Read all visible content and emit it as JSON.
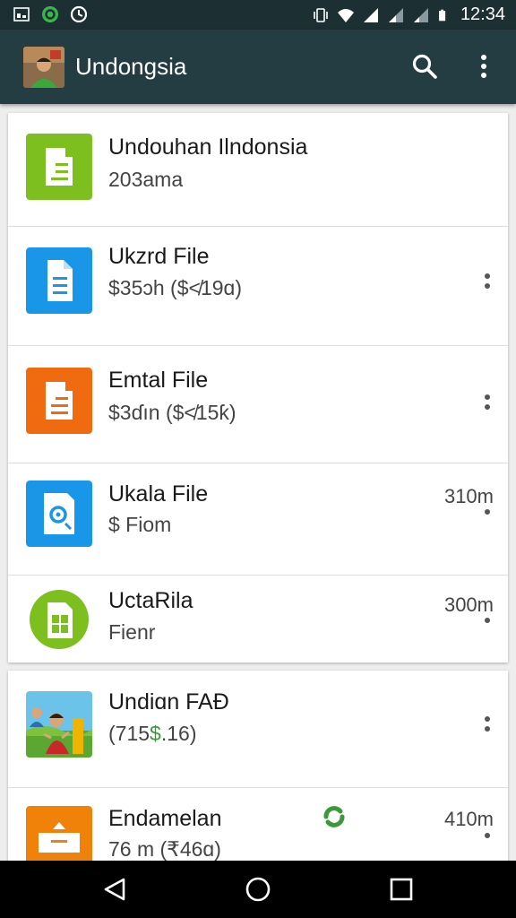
{
  "status_bar": {
    "time": "12:34",
    "icons": [
      "notification-icon",
      "sync-icon",
      "data-saver-icon",
      "vibrate-icon",
      "wifi-icon",
      "signal-icon",
      "signal-icon",
      "battery-icon"
    ]
  },
  "app_bar": {
    "title": "Undongsia",
    "icons": [
      "avatar",
      "search-icon",
      "more-vert-icon"
    ]
  },
  "list_group_1": [
    {
      "title": "Undouhan Ilndonsia",
      "subtitle": "203ama",
      "meta": "",
      "icon": "document-icon",
      "icon_color": "#7cbf1f",
      "has_menu": false
    },
    {
      "title": "Ukzrd File",
      "subtitle": "$35ɔh ($≮19ɑ)",
      "meta": "",
      "icon": "file-icon",
      "icon_color": "#1a96e8",
      "has_menu": true
    },
    {
      "title": "Emtal File",
      "subtitle": "$3ɗın ($≮15ƙ)",
      "meta": "",
      "icon": "document-icon",
      "icon_color": "#f06a10",
      "has_menu": true
    },
    {
      "title": "Ukala File",
      "subtitle": "$ Fiom",
      "meta": "310m",
      "icon": "audio-file-icon",
      "icon_color": "#1a96e8",
      "has_menu": true
    },
    {
      "title": "UctaRila",
      "subtitle": "Fienr",
      "meta": "300m",
      "icon": "spreadsheet-icon",
      "icon_color": "#7cbf1f",
      "has_menu": true
    }
  ],
  "list_group_2": [
    {
      "title": "Undiɑn FAÐ",
      "subtitle_before": "(715",
      "subtitle_accent": "$",
      "subtitle_after": ".16)",
      "meta": "",
      "icon": "photo-thumbnail",
      "has_menu": true
    },
    {
      "title": "Endamelan",
      "subtitle": "76 m (₹46ɑ)",
      "meta": "410m",
      "icon": "archive-icon",
      "icon_color": "#f0820a",
      "has_menu": true
    }
  ],
  "colors": {
    "status_bar": "#1c2f33",
    "app_bar": "#243d42",
    "accent_green": "#3a9a3a"
  },
  "nav_bar": [
    "back-button",
    "home-button",
    "recents-button"
  ]
}
